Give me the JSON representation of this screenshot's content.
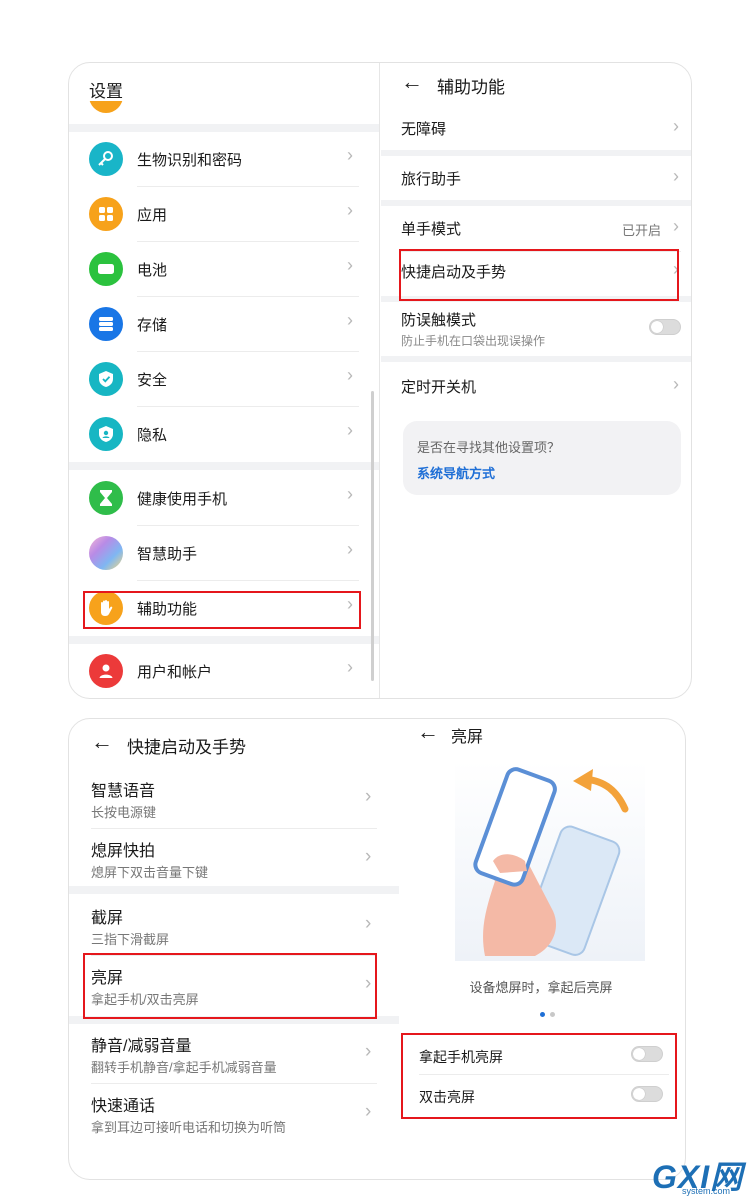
{
  "settings": {
    "title": "设置",
    "items": [
      {
        "label": "生物识别和密码",
        "icon": "key-icon",
        "color": "#19b5c8"
      },
      {
        "label": "应用",
        "icon": "apps-icon",
        "color": "#f7a21b"
      },
      {
        "label": "电池",
        "icon": "battery-icon",
        "color": "#2bc23e"
      },
      {
        "label": "存储",
        "icon": "storage-icon",
        "color": "#1976e6"
      },
      {
        "label": "安全",
        "icon": "shield-icon",
        "color": "#17b6c3"
      },
      {
        "label": "隐私",
        "icon": "privacy-icon",
        "color": "#17b6c3"
      },
      {
        "label": "健康使用手机",
        "icon": "hourglass-icon",
        "color": "#2fbd4a"
      },
      {
        "label": "智慧助手",
        "icon": "assistant-icon",
        "color": "#b88be6"
      },
      {
        "label": "辅助功能",
        "icon": "hand-icon",
        "color": "#f7a21b"
      },
      {
        "label": "用户和帐户",
        "icon": "user-icon",
        "color": "#ec3a3a"
      }
    ]
  },
  "accessibility": {
    "title": "辅助功能",
    "items": [
      {
        "label": "无障碍"
      },
      {
        "label": "旅行助手"
      },
      {
        "label": "单手模式",
        "status": "已开启"
      },
      {
        "label": "快捷启动及手势"
      },
      {
        "label": "防误触模式",
        "sub": "防止手机在口袋出现误操作"
      },
      {
        "label": "定时开关机"
      }
    ],
    "card": {
      "question": "是否在寻找其他设置项？",
      "link": "系统导航方式"
    }
  },
  "gestures": {
    "title": "快捷启动及手势",
    "items": [
      {
        "title": "智慧语音",
        "sub": "长按电源键"
      },
      {
        "title": "熄屏快拍",
        "sub": "熄屏下双击音量下键"
      },
      {
        "title": "截屏",
        "sub": "三指下滑截屏"
      },
      {
        "title": "亮屏",
        "sub": "拿起手机/双击亮屏"
      },
      {
        "title": "静音/减弱音量",
        "sub": "翻转手机静音/拿起手机减弱音量"
      },
      {
        "title": "快速通话",
        "sub": "拿到耳边可接听电话和切换为听筒"
      }
    ]
  },
  "wake": {
    "title": "亮屏",
    "caption": "设备熄屏时，拿起后亮屏",
    "page_count": 2,
    "active_page": 1,
    "options": [
      {
        "label": "拿起手机亮屏",
        "enabled": false
      },
      {
        "label": "双击亮屏",
        "enabled": false
      }
    ]
  },
  "colors": {
    "highlight": "#e5171c",
    "link": "#1f6fd6"
  },
  "watermark": {
    "brand": "GXI网",
    "site": "system.com"
  }
}
